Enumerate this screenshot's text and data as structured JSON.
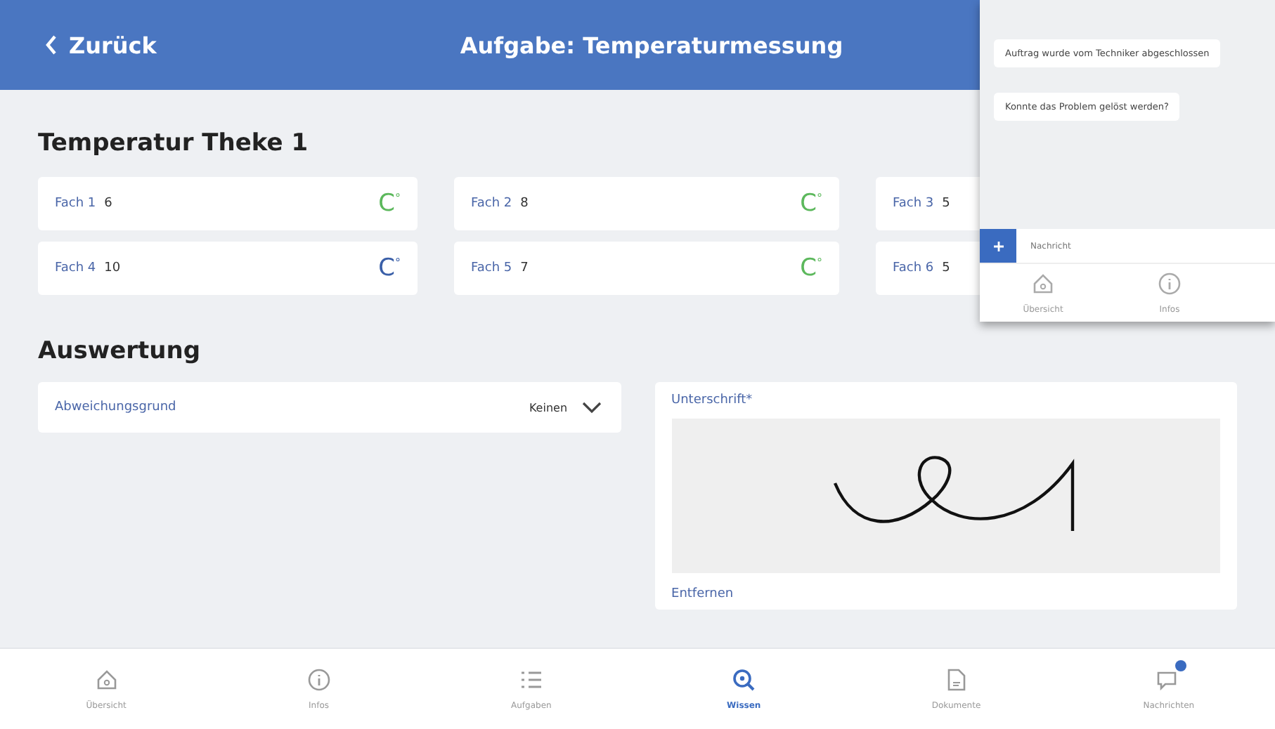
{
  "header": {
    "back": "Zurück",
    "title": "Aufgabe: Temperaturmessung"
  },
  "section_title": "Temperatur Theke 1",
  "compartments": [
    {
      "label": "Fach 1",
      "value": "6",
      "unit": "C$^{°}$",
      "color": "#5cb85c"
    },
    {
      "label": "Fach 2",
      "value": "8",
      "unit": "C$^{°}$",
      "color": "#5cb85c"
    },
    {
      "label": "Fach 3",
      "value": "5"
    },
    {
      "label": "Fach 4",
      "value": "10",
      "unit": "C$^{°}$",
      "color": "#3a5fa8"
    },
    {
      "label": "Fach 5",
      "value": "7",
      "unit": "C$^{°}$",
      "color": "#5cb85c"
    },
    {
      "label": "Fach 6",
      "value": "5"
    }
  ],
  "evaluation": {
    "title": "Auswertung",
    "reason_label": "Abweichungsgrund",
    "reason_value": "Keinen",
    "signature_label": "Unterschrift*",
    "remove": "Entfernen"
  },
  "nav": [
    {
      "label": "Übersicht",
      "kind": "home",
      "selected": false
    },
    {
      "label": "Infos",
      "kind": "info",
      "selected": false
    },
    {
      "label": "Aufgaben",
      "kind": "list",
      "selected": false
    },
    {
      "label": "Wissen",
      "kind": "search",
      "selected": true
    },
    {
      "label": "Dokumente",
      "kind": "doc",
      "selected": false
    },
    {
      "label": "Nachrichten",
      "kind": "chat",
      "selected": false,
      "badge": true
    }
  ],
  "chat": {
    "messages": [
      "Auftrag wurde vom Techniker abgeschlossen",
      "Konnte das Problem gelöst werden?"
    ],
    "placeholder": "Nachricht",
    "nav": [
      {
        "label": "Übersicht",
        "kind": "home"
      },
      {
        "label": "Infos",
        "kind": "info"
      }
    ]
  }
}
